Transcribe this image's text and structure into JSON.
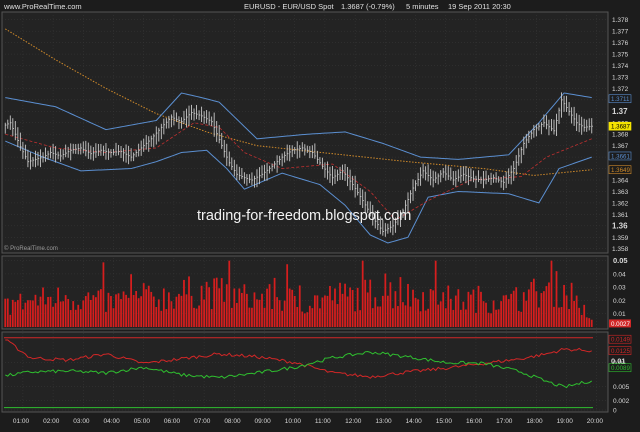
{
  "header": {
    "brand": "www.ProRealTime.com",
    "instrument": "EURUSD - EUR/USD Spot",
    "last": "1.3687 (-0.79%)",
    "interval": "5 minutes",
    "datetime": "19 Sep 2011 20:30"
  },
  "watermark": "trading-for-freedom.blogspot.com",
  "footer_brand": "© ProRealTime.com",
  "colors": {
    "bg": "#1c1c1c",
    "panel_bg": "#262626",
    "grid": "#3a3a3a",
    "axis_text": "#d8d8d8",
    "candle": "#c8c8c8",
    "bollinger": "#5b8fd1",
    "ma_long": "#d08a2a",
    "ma_short": "#c23030",
    "volume": "#d61e1e",
    "ind_green": "#2fbf2f",
    "ind_red": "#d22727",
    "label_yellow": "#f5e400",
    "label_blue": "#5b8fd1",
    "label_orange": "#d08a2a"
  },
  "chart_data": [
    {
      "type": "candlestick",
      "panel": "price",
      "x_ticks": [
        "01:00",
        "02:00",
        "03:00",
        "04:00",
        "05:00",
        "06:00",
        "07:00",
        "08:00",
        "09:00",
        "10:00",
        "11:00",
        "12:00",
        "13:00",
        "14:00",
        "15:00",
        "16:00",
        "17:00",
        "18:00",
        "19:00",
        "20:00"
      ],
      "y_ticks": [
        "1.378",
        "1.377",
        "1.376",
        "1.375",
        "1.374",
        "1.373",
        "1.372",
        "1.371",
        "1.37",
        "1.369",
        "1.368",
        "1.367",
        "1.366",
        "1.365",
        "1.364",
        "1.363",
        "1.362",
        "1.361",
        "1.36",
        "1.359",
        "1.358"
      ],
      "ylim": [
        1.3578,
        1.3785
      ],
      "value_labels": [
        {
          "text": "1.3711",
          "value": 1.3711,
          "color_key": "label_blue"
        },
        {
          "text": "1.3687",
          "value": 1.3687,
          "color_key": "label_yellow"
        },
        {
          "text": "1.3661",
          "value": 1.3661,
          "color_key": "label_blue"
        },
        {
          "text": "1.3649",
          "value": 1.3649,
          "color_key": "label_orange"
        }
      ],
      "close_anchors": [
        [
          0,
          1.3688
        ],
        [
          2,
          1.369
        ],
        [
          4,
          1.368
        ],
        [
          6,
          1.3669
        ],
        [
          9,
          1.3656
        ],
        [
          12,
          1.3658
        ],
        [
          15,
          1.366
        ],
        [
          18,
          1.3664
        ],
        [
          22,
          1.3661
        ],
        [
          26,
          1.3666
        ],
        [
          30,
          1.3668
        ],
        [
          34,
          1.3663
        ],
        [
          38,
          1.3666
        ],
        [
          42,
          1.3664
        ],
        [
          46,
          1.3665
        ],
        [
          50,
          1.366
        ],
        [
          54,
          1.3668
        ],
        [
          58,
          1.3676
        ],
        [
          62,
          1.3686
        ],
        [
          66,
          1.3695
        ],
        [
          70,
          1.3691
        ],
        [
          74,
          1.3699
        ],
        [
          78,
          1.3696
        ],
        [
          82,
          1.3691
        ],
        [
          86,
          1.367
        ],
        [
          89,
          1.3655
        ],
        [
          92,
          1.3645
        ],
        [
          95,
          1.3642
        ],
        [
          98,
          1.364
        ],
        [
          102,
          1.3645
        ],
        [
          106,
          1.3652
        ],
        [
          110,
          1.366
        ],
        [
          114,
          1.3666
        ],
        [
          118,
          1.3668
        ],
        [
          122,
          1.3664
        ],
        [
          126,
          1.3652
        ],
        [
          130,
          1.3642
        ],
        [
          134,
          1.3648
        ],
        [
          138,
          1.3636
        ],
        [
          142,
          1.3622
        ],
        [
          146,
          1.3607
        ],
        [
          150,
          1.3595
        ],
        [
          154,
          1.36
        ],
        [
          158,
          1.3613
        ],
        [
          162,
          1.3633
        ],
        [
          166,
          1.3648
        ],
        [
          170,
          1.364
        ],
        [
          174,
          1.3647
        ],
        [
          178,
          1.364
        ],
        [
          182,
          1.3645
        ],
        [
          186,
          1.3641
        ],
        [
          190,
          1.364
        ],
        [
          194,
          1.3642
        ],
        [
          198,
          1.3638
        ],
        [
          202,
          1.365
        ],
        [
          206,
          1.3672
        ],
        [
          210,
          1.3684
        ],
        [
          214,
          1.369
        ],
        [
          218,
          1.3683
        ],
        [
          221,
          1.371
        ],
        [
          224,
          1.37
        ],
        [
          227,
          1.369
        ],
        [
          230,
          1.3686
        ],
        [
          233,
          1.3687
        ]
      ],
      "bollinger_upper": [
        [
          0,
          1.3712
        ],
        [
          20,
          1.3704
        ],
        [
          40,
          1.3684
        ],
        [
          60,
          1.3692
        ],
        [
          70,
          1.3716
        ],
        [
          78,
          1.3712
        ],
        [
          85,
          1.3708
        ],
        [
          100,
          1.3676
        ],
        [
          120,
          1.368
        ],
        [
          135,
          1.3682
        ],
        [
          150,
          1.3672
        ],
        [
          165,
          1.366
        ],
        [
          180,
          1.3658
        ],
        [
          200,
          1.3662
        ],
        [
          212,
          1.369
        ],
        [
          222,
          1.3716
        ],
        [
          233,
          1.3712
        ]
      ],
      "bollinger_lower": [
        [
          0,
          1.3674
        ],
        [
          15,
          1.366
        ],
        [
          30,
          1.3648
        ],
        [
          50,
          1.365
        ],
        [
          60,
          1.3656
        ],
        [
          70,
          1.3664
        ],
        [
          80,
          1.3666
        ],
        [
          88,
          1.365
        ],
        [
          95,
          1.3632
        ],
        [
          110,
          1.3646
        ],
        [
          125,
          1.3636
        ],
        [
          135,
          1.3618
        ],
        [
          145,
          1.3592
        ],
        [
          152,
          1.3585
        ],
        [
          160,
          1.359
        ],
        [
          168,
          1.3625
        ],
        [
          180,
          1.363
        ],
        [
          200,
          1.3628
        ],
        [
          212,
          1.362
        ],
        [
          220,
          1.365
        ],
        [
          233,
          1.366
        ]
      ],
      "ma_long": [
        [
          0,
          1.3772
        ],
        [
          20,
          1.3745
        ],
        [
          40,
          1.372
        ],
        [
          60,
          1.3698
        ],
        [
          80,
          1.3682
        ],
        [
          100,
          1.367
        ],
        [
          130,
          1.3663
        ],
        [
          160,
          1.3656
        ],
        [
          190,
          1.365
        ],
        [
          210,
          1.3644
        ],
        [
          233,
          1.3649
        ]
      ],
      "ma_short": [
        [
          0,
          1.368
        ],
        [
          20,
          1.3668
        ],
        [
          40,
          1.3664
        ],
        [
          60,
          1.3668
        ],
        [
          75,
          1.369
        ],
        [
          85,
          1.3686
        ],
        [
          95,
          1.3664
        ],
        [
          110,
          1.365
        ],
        [
          130,
          1.3654
        ],
        [
          145,
          1.363
        ],
        [
          155,
          1.3605
        ],
        [
          168,
          1.3622
        ],
        [
          185,
          1.364
        ],
        [
          205,
          1.3643
        ],
        [
          215,
          1.366
        ],
        [
          233,
          1.3676
        ]
      ]
    },
    {
      "type": "bar",
      "panel": "volume",
      "y_ticks": [
        "0.05",
        "0.04",
        "0.03",
        "0.02",
        "0.01"
      ],
      "ylim": [
        0,
        0.052
      ],
      "value_labels": [
        {
          "text": "0.0027",
          "value": 0.0027,
          "color_key": "ind_red"
        }
      ],
      "envelope": [
        [
          0,
          0.018
        ],
        [
          10,
          0.022
        ],
        [
          20,
          0.024
        ],
        [
          30,
          0.024
        ],
        [
          40,
          0.021
        ],
        [
          50,
          0.022
        ],
        [
          60,
          0.024
        ],
        [
          70,
          0.028
        ],
        [
          80,
          0.03
        ],
        [
          90,
          0.026
        ],
        [
          100,
          0.024
        ],
        [
          110,
          0.024
        ],
        [
          120,
          0.02
        ],
        [
          130,
          0.026
        ],
        [
          140,
          0.026
        ],
        [
          150,
          0.03
        ],
        [
          160,
          0.026
        ],
        [
          170,
          0.026
        ],
        [
          180,
          0.022
        ],
        [
          190,
          0.024
        ],
        [
          200,
          0.02
        ],
        [
          210,
          0.028
        ],
        [
          220,
          0.032
        ],
        [
          226,
          0.026
        ],
        [
          233,
          0.006
        ]
      ]
    },
    {
      "type": "line",
      "panel": "indicator",
      "y_ticks": [
        "0.01",
        "0.005",
        "0.002",
        "0"
      ],
      "ylim": [
        0,
        0.016
      ],
      "value_labels": [
        {
          "text": "0.0149",
          "value": 0.0149,
          "color_key": "ind_red"
        },
        {
          "text": "0.0125",
          "value": 0.0125,
          "color_key": "ind_red"
        },
        {
          "text": "0.01",
          "value": 0.0103,
          "color_key": "axis_text"
        },
        {
          "text": "0.0089",
          "value": 0.0089,
          "color_key": "ind_green"
        }
      ],
      "series": [
        {
          "color_key": "ind_red",
          "values": [
            [
              0,
              0.0148
            ],
            [
              10,
              0.011
            ],
            [
              25,
              0.0105
            ],
            [
              40,
              0.0118
            ],
            [
              55,
              0.0098
            ],
            [
              70,
              0.0108
            ],
            [
              85,
              0.0118
            ],
            [
              100,
              0.0112
            ],
            [
              115,
              0.01
            ],
            [
              130,
              0.0078
            ],
            [
              145,
              0.007
            ],
            [
              160,
              0.008
            ],
            [
              175,
              0.0088
            ],
            [
              190,
              0.0098
            ],
            [
              205,
              0.0108
            ],
            [
              215,
              0.0118
            ],
            [
              222,
              0.0128
            ],
            [
              233,
              0.0125
            ]
          ]
        },
        {
          "color_key": "ind_green",
          "values": [
            [
              0,
              0.0072
            ],
            [
              10,
              0.008
            ],
            [
              25,
              0.0082
            ],
            [
              40,
              0.0078
            ],
            [
              55,
              0.009
            ],
            [
              70,
              0.0074
            ],
            [
              85,
              0.0068
            ],
            [
              100,
              0.0078
            ],
            [
              115,
              0.009
            ],
            [
              130,
              0.011
            ],
            [
              145,
              0.0122
            ],
            [
              160,
              0.0112
            ],
            [
              175,
              0.01
            ],
            [
              190,
              0.0098
            ],
            [
              205,
              0.008
            ],
            [
              215,
              0.006
            ],
            [
              222,
              0.0048
            ],
            [
              233,
              0.0062
            ]
          ]
        }
      ],
      "hlines": [
        {
          "value": 0.0152,
          "color_key": "ind_red"
        },
        {
          "value": 0.0005,
          "color_key": "ind_green"
        }
      ]
    }
  ]
}
